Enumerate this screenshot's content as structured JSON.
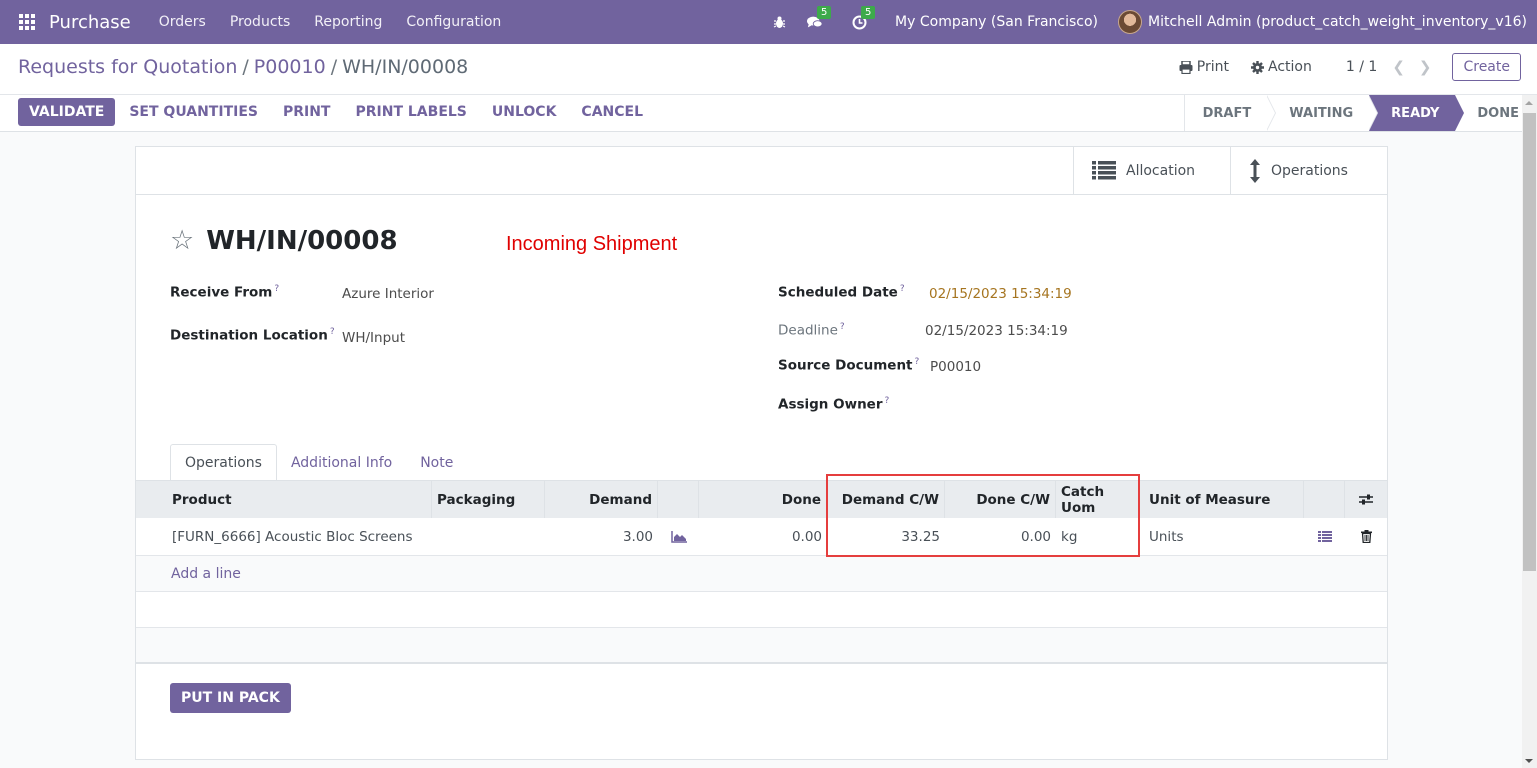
{
  "navbar": {
    "app_name": "Purchase",
    "menu": [
      "Orders",
      "Products",
      "Reporting",
      "Configuration"
    ],
    "messages_badge": "5",
    "activities_badge": "5",
    "company": "My Company (San Francisco)",
    "user": "Mitchell Admin (product_catch_weight_inventory_v16)",
    "icons": [
      "apps-grid-icon",
      "bug-icon",
      "chat-icon",
      "clock-icon",
      "avatar"
    ]
  },
  "control_panel": {
    "breadcrumb": [
      "Requests for Quotation",
      "P00010",
      "WH/IN/00008"
    ],
    "print_label": "Print",
    "action_label": "Action",
    "pager": "1 / 1",
    "create_label": "Create",
    "buttons": [
      "VALIDATE",
      "SET QUANTITIES",
      "PRINT",
      "PRINT LABELS",
      "UNLOCK",
      "CANCEL"
    ],
    "statuses": [
      "DRAFT",
      "WAITING",
      "READY",
      "DONE"
    ],
    "active_status": "READY"
  },
  "sheet": {
    "smart_buttons": [
      "Allocation",
      "Operations"
    ],
    "record_name": "WH/IN/00008",
    "picking_type": "Incoming Shipment",
    "fields_left": [
      {
        "label": "Receive From",
        "value": "Azure Interior"
      },
      {
        "label": "Destination Location",
        "value": "WH/Input"
      }
    ],
    "fields_right": [
      {
        "label": "Scheduled Date",
        "value": "02/15/2023 15:34:19"
      },
      {
        "label": "Deadline",
        "value": "02/15/2023 15:34:19"
      },
      {
        "label": "Source Document",
        "value": "P00010"
      },
      {
        "label": "Assign Owner",
        "value": ""
      }
    ],
    "help_mark": "?",
    "tabs": [
      "Operations",
      "Additional Info",
      "Note"
    ],
    "active_tab": "Operations",
    "table": {
      "columns": [
        "Product",
        "Packaging",
        "Demand",
        "",
        "Done",
        "Demand C/W",
        "Done C/W",
        "Catch Uom",
        "Unit of Measure"
      ],
      "rows": [
        {
          "product": "[FURN_6666] Acoustic Bloc Screens",
          "packaging": "",
          "demand": "3.00",
          "done": "0.00",
          "demand_cw": "33.25",
          "done_cw": "0.00",
          "catch_uom": "kg",
          "uom": "Units"
        }
      ],
      "add_line": "Add a line"
    },
    "put_in_pack": "PUT IN PACK"
  }
}
